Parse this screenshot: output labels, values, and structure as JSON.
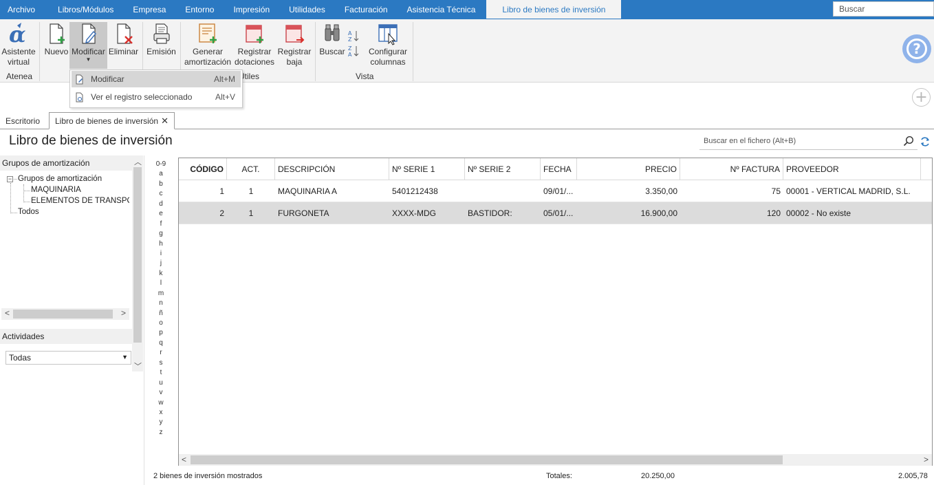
{
  "menu": {
    "items": [
      "Archivo",
      "Libros/Módulos",
      "Empresa",
      "Entorno",
      "Impresión",
      "Utilidades",
      "Facturación",
      "Asistencia Técnica"
    ],
    "active_tab": "Libro de bienes de inversión",
    "search_placeholder": "Buscar"
  },
  "ribbon": {
    "asistente": "Asistente\nvirtual",
    "nuevo": "Nuevo",
    "modificar": "Modificar",
    "eliminar": "Eliminar",
    "emision": "Emisión",
    "generar": "Generar\namortización",
    "registrar_dotaciones": "Registrar\ndotaciones",
    "registrar_baja": "Registrar\nbaja",
    "buscar": "Buscar",
    "configurar": "Configurar\ncolumnas",
    "groups": {
      "atenea": "Atenea",
      "utiles": "Útiles",
      "vista": "Vista"
    }
  },
  "dropdown": {
    "items": [
      {
        "label": "Modificar",
        "shortcut": "Alt+M"
      },
      {
        "label": "Ver el registro seleccionado",
        "shortcut": "Alt+V"
      }
    ]
  },
  "tabs": {
    "escritorio": "Escritorio",
    "libro": "Libro de bienes de inversión",
    "close": "✕"
  },
  "page": {
    "title": "Libro de bienes de inversión",
    "search_placeholder": "Buscar en el fichero (Alt+B)"
  },
  "left": {
    "grupos_header": "Grupos de amortización",
    "tree": {
      "root": "Grupos de amortización",
      "children": [
        "MAQUINARIA",
        "ELEMENTOS DE TRANSPORT"
      ],
      "todos": "Todos"
    },
    "actividades_header": "Actividades",
    "actividades_value": "Todas"
  },
  "alphabet": [
    "0-9",
    "a",
    "b",
    "c",
    "d",
    "e",
    "f",
    "g",
    "h",
    "i",
    "j",
    "k",
    "l",
    "m",
    "n",
    "ñ",
    "o",
    "p",
    "q",
    "r",
    "s",
    "t",
    "u",
    "v",
    "w",
    "x",
    "y",
    "z"
  ],
  "grid": {
    "columns": [
      "CÓDIGO",
      "ACT.",
      "DESCRIPCIÓN",
      "Nº SERIE 1",
      "Nº SERIE 2",
      "FECHA",
      "PRECIO",
      "Nº FACTURA",
      "PROVEEDOR"
    ],
    "rows": [
      {
        "codigo": "1",
        "act": "1",
        "descripcion": "MAQUINARIA A",
        "serie1": "5401212438",
        "serie2": "",
        "fecha": "09/01/...",
        "precio": "3.350,00",
        "factura": "75",
        "proveedor": "00001 - VERTICAL MADRID, S.L."
      },
      {
        "codigo": "2",
        "act": "1",
        "descripcion": "FURGONETA",
        "serie1": "XXXX-MDG",
        "serie2": "BASTIDOR:",
        "fecha": "05/01/...",
        "precio": "16.900,00",
        "factura": "120",
        "proveedor": "00002 - No existe"
      }
    ]
  },
  "footer": {
    "count": "2 bienes de inversión mostrados",
    "totales_label": "Totales:",
    "total_precio": "20.250,00",
    "total_other": "2.005,78"
  },
  "colors": {
    "menubar": "#2b79c2",
    "selected_row": "#dcdcdc",
    "help": "#8fb3ea"
  }
}
